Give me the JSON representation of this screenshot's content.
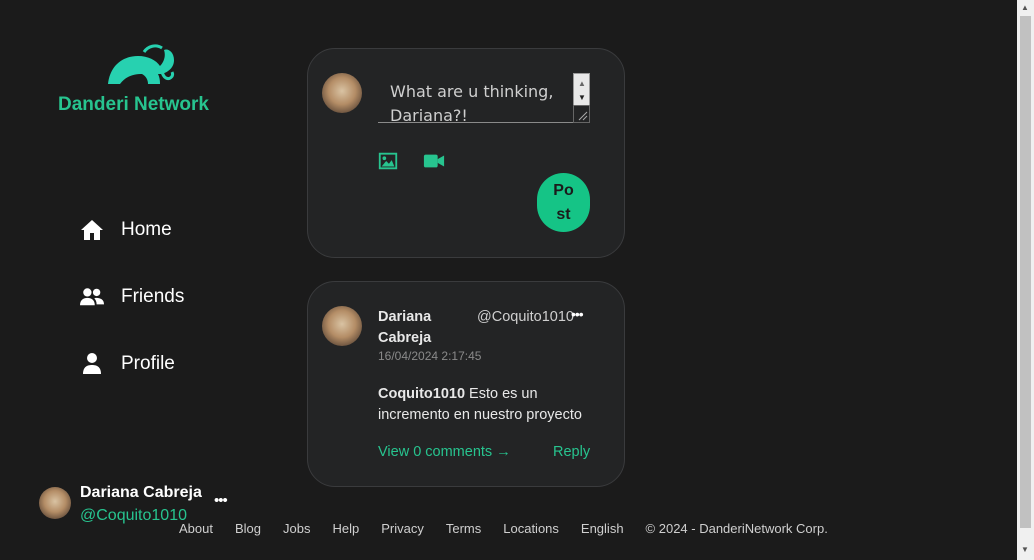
{
  "brand": {
    "name": "Danderi Network",
    "logo_icon": "elephant-logo-icon",
    "accent_color": "#27c48f"
  },
  "nav": {
    "items": [
      {
        "label": "Home",
        "icon": "home-icon"
      },
      {
        "label": "Friends",
        "icon": "users-icon"
      },
      {
        "label": "Profile",
        "icon": "user-icon"
      }
    ]
  },
  "current_user": {
    "name": "Dariana Cabreja",
    "handle": "@Coquito1010",
    "more": "•••"
  },
  "composer": {
    "placeholder": "What are u thinking, Dariana?!",
    "post_label": "Post",
    "media_icons": [
      "image-icon",
      "video-icon"
    ]
  },
  "post": {
    "author": "Dariana Cabreja",
    "handle": "@Coquito1010",
    "more": "•••",
    "date": "16/04/2024 2:17:45",
    "mention": "Coquito1010",
    "text": "Esto es un incremento en nuestro proyecto",
    "view_comments": "View 0 comments →",
    "reply": "Reply"
  },
  "footer": {
    "links": [
      "About",
      "Blog",
      "Jobs",
      "Help",
      "Privacy",
      "Terms",
      "Locations",
      "English"
    ],
    "copyright": "© 2024 - DanderiNetwork Corp."
  }
}
